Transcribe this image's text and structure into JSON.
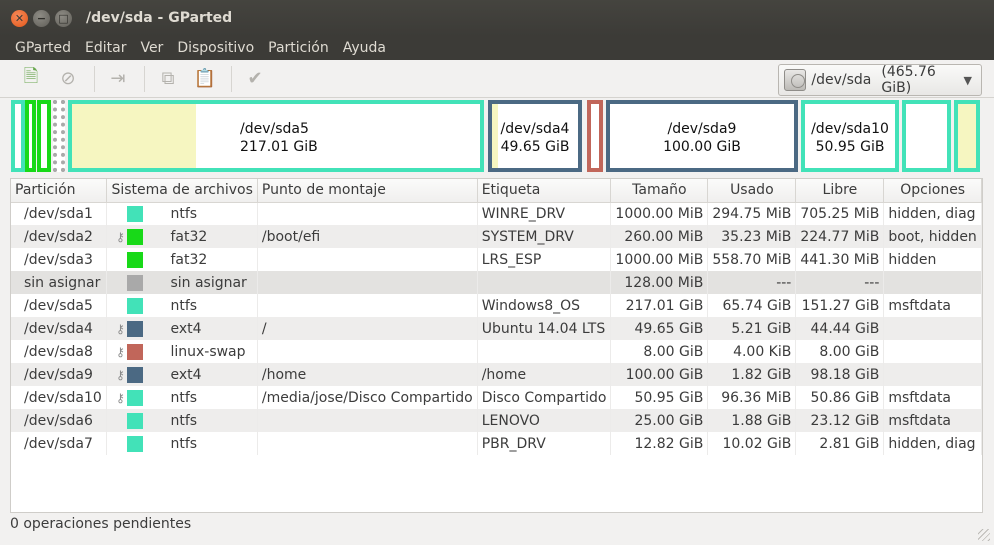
{
  "window": {
    "title": "/dev/sda - GParted"
  },
  "menu": [
    "GParted",
    "Editar",
    "Ver",
    "Dispositivo",
    "Partición",
    "Ayuda"
  ],
  "toolbar": {
    "buttons": [
      {
        "name": "new-partition-icon",
        "glyph": "🗎"
      },
      {
        "name": "delete-icon",
        "glyph": "⊘"
      },
      {
        "name": "resize-move-icon",
        "glyph": "⇥"
      },
      {
        "name": "copy-icon",
        "glyph": "⧉"
      },
      {
        "name": "paste-icon",
        "glyph": "📋"
      },
      {
        "name": "apply-icon",
        "glyph": "✔"
      }
    ],
    "device": "/dev/sda",
    "device_size": "(465.76 GiB)"
  },
  "diskmap": {
    "sda5": {
      "name": "/dev/sda5",
      "size": "217.01 GiB"
    },
    "sda4": {
      "name": "/dev/sda4",
      "size": "49.65 GiB"
    },
    "sda9": {
      "name": "/dev/sda9",
      "size": "100.00 GiB"
    },
    "sda10": {
      "name": "/dev/sda10",
      "size": "50.95 GiB"
    }
  },
  "colors": {
    "ntfs": "#42e2b8",
    "fat32": "#18d918",
    "unallocated": "#a9a9a9",
    "ext4": "#4b6983",
    "linux_swap": "#c1665a"
  },
  "table": {
    "headers": {
      "partition": "Partición",
      "fs": "Sistema de archivos",
      "mount": "Punto de montaje",
      "label": "Etiqueta",
      "size": "Tamaño",
      "used": "Usado",
      "free": "Libre",
      "flags": "Opciones"
    },
    "rows": [
      {
        "partition": "/dev/sda1",
        "key": false,
        "color": "#42e2b8",
        "fs": "ntfs",
        "mount": "",
        "label": "WINRE_DRV",
        "size": "1000.00 MiB",
        "used": "294.75 MiB",
        "free": "705.25 MiB",
        "flags": "hidden, diag"
      },
      {
        "partition": "/dev/sda2",
        "key": true,
        "color": "#18d918",
        "fs": "fat32",
        "mount": "/boot/efi",
        "label": "SYSTEM_DRV",
        "size": "260.00 MiB",
        "used": "35.23 MiB",
        "free": "224.77 MiB",
        "flags": "boot, hidden"
      },
      {
        "partition": "/dev/sda3",
        "key": false,
        "color": "#18d918",
        "fs": "fat32",
        "mount": "",
        "label": "LRS_ESP",
        "size": "1000.00 MiB",
        "used": "558.70 MiB",
        "free": "441.30 MiB",
        "flags": "hidden"
      },
      {
        "partition": "sin asignar",
        "key": false,
        "color": "#a9a9a9",
        "fs": "sin asignar",
        "mount": "",
        "label": "",
        "size": "128.00 MiB",
        "used": "---",
        "free": "---",
        "flags": "",
        "unalloc": true
      },
      {
        "partition": "/dev/sda5",
        "key": false,
        "color": "#42e2b8",
        "fs": "ntfs",
        "mount": "",
        "label": "Windows8_OS",
        "size": "217.01 GiB",
        "used": "65.74 GiB",
        "free": "151.27 GiB",
        "flags": "msftdata"
      },
      {
        "partition": "/dev/sda4",
        "key": true,
        "color": "#4b6983",
        "fs": "ext4",
        "mount": "/",
        "label": "Ubuntu 14.04 LTS",
        "size": "49.65 GiB",
        "used": "5.21 GiB",
        "free": "44.44 GiB",
        "flags": ""
      },
      {
        "partition": "/dev/sda8",
        "key": true,
        "color": "#c1665a",
        "fs": "linux-swap",
        "mount": "",
        "label": "",
        "size": "8.00 GiB",
        "used": "4.00 KiB",
        "free": "8.00 GiB",
        "flags": ""
      },
      {
        "partition": "/dev/sda9",
        "key": true,
        "color": "#4b6983",
        "fs": "ext4",
        "mount": "/home",
        "label": "/home",
        "size": "100.00 GiB",
        "used": "1.82 GiB",
        "free": "98.18 GiB",
        "flags": ""
      },
      {
        "partition": "/dev/sda10",
        "key": true,
        "color": "#42e2b8",
        "fs": "ntfs",
        "mount": "/media/jose/Disco Compartido",
        "label": "Disco Compartido",
        "size": "50.95 GiB",
        "used": "96.36 MiB",
        "free": "50.86 GiB",
        "flags": "msftdata"
      },
      {
        "partition": "/dev/sda6",
        "key": false,
        "color": "#42e2b8",
        "fs": "ntfs",
        "mount": "",
        "label": "LENOVO",
        "size": "25.00 GiB",
        "used": "1.88 GiB",
        "free": "23.12 GiB",
        "flags": "msftdata"
      },
      {
        "partition": "/dev/sda7",
        "key": false,
        "color": "#42e2b8",
        "fs": "ntfs",
        "mount": "",
        "label": "PBR_DRV",
        "size": "12.82 GiB",
        "used": "10.02 GiB",
        "free": "2.81 GiB",
        "flags": "hidden, diag"
      }
    ]
  },
  "status": "0 operaciones pendientes"
}
